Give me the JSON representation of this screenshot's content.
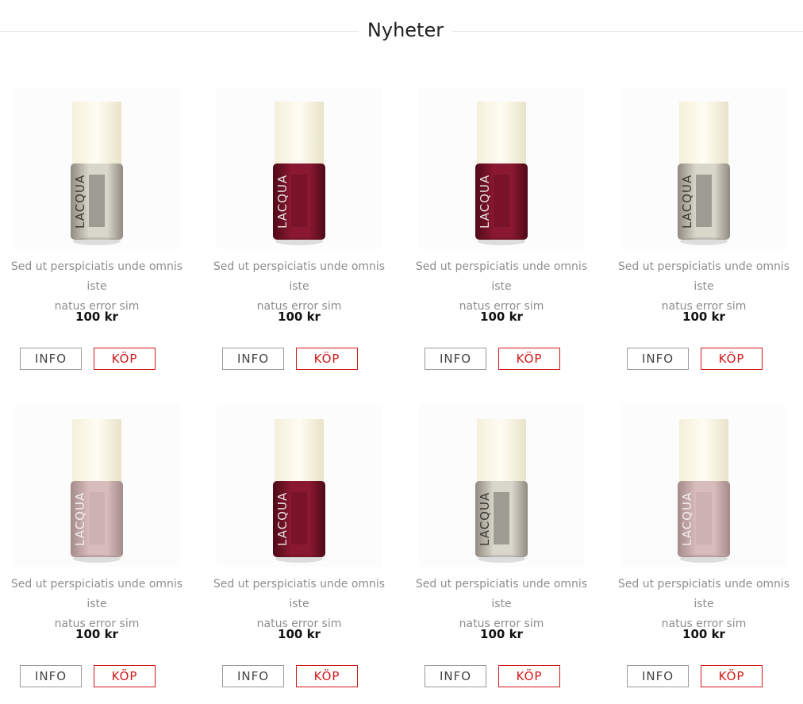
{
  "section": {
    "title": "Nyheter"
  },
  "colors": {
    "buy_accent": "#d01818",
    "price_text": "#111111",
    "description_text": "#8e8e8e"
  },
  "products": [
    {
      "brand": "LACQUA",
      "variant": "clear",
      "description_line1": "Sed ut perspiciatis unde omnis iste",
      "description_line2": "natus error sim",
      "price": "100 kr",
      "info_label": "INFO",
      "buy_label": "KÖP"
    },
    {
      "brand": "LACQUA",
      "variant": "burgundy",
      "description_line1": "Sed ut perspiciatis unde omnis iste",
      "description_line2": "natus error sim",
      "price": "100 kr",
      "info_label": "INFO",
      "buy_label": "KÖP"
    },
    {
      "brand": "LACQUA",
      "variant": "burgundy",
      "description_line1": "Sed ut perspiciatis unde omnis iste",
      "description_line2": "natus error sim",
      "price": "100 kr",
      "info_label": "INFO",
      "buy_label": "KÖP"
    },
    {
      "brand": "LACQUA",
      "variant": "clear",
      "description_line1": "Sed ut perspiciatis unde omnis iste",
      "description_line2": "natus error sim",
      "price": "100 kr",
      "info_label": "INFO",
      "buy_label": "KÖP"
    },
    {
      "brand": "LACQUA",
      "variant": "nude",
      "description_line1": "Sed ut perspiciatis unde omnis iste",
      "description_line2": "natus error sim",
      "price": "100 kr",
      "info_label": "INFO",
      "buy_label": "KÖP"
    },
    {
      "brand": "LACQUA",
      "variant": "burgundy",
      "description_line1": "Sed ut perspiciatis unde omnis iste",
      "description_line2": "natus error sim",
      "price": "100 kr",
      "info_label": "INFO",
      "buy_label": "KÖP"
    },
    {
      "brand": "LACQUA",
      "variant": "clear",
      "description_line1": "Sed ut perspiciatis unde omnis iste",
      "description_line2": "natus error sim",
      "price": "100 kr",
      "info_label": "INFO",
      "buy_label": "KÖP"
    },
    {
      "brand": "LACQUA",
      "variant": "nude",
      "description_line1": "Sed ut perspiciatis unde omnis iste",
      "description_line2": "natus error sim",
      "price": "100 kr",
      "info_label": "INFO",
      "buy_label": "KÖP"
    }
  ]
}
